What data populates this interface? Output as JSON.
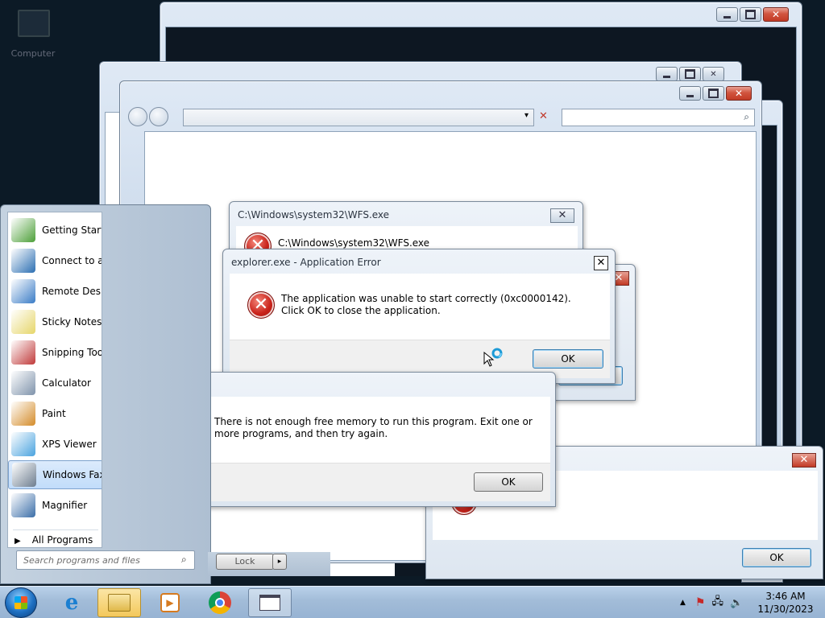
{
  "desktop": {
    "computer_icon_label": "Computer"
  },
  "explorer": {
    "search_icon": "search-icon"
  },
  "dialog_wfs": {
    "title": "C:\\Windows\\system32\\WFS.exe",
    "message": "C:\\Windows\\system32\\WFS.exe"
  },
  "dialog_explorer": {
    "title": "explorer.exe - Application Error",
    "message": "The application was unable to start correctly (0xc0000142). Click OK to close the application.",
    "ok_label": "OK"
  },
  "dialog_memory": {
    "message": "There is not enough free memory to run this program. Exit one or more programs, and then try again.",
    "ok_label": "OK"
  },
  "dialog_bottom_right": {
    "ok_label": "OK"
  },
  "dialog_partial": {
    "ok_label": "Lock"
  },
  "start_menu": {
    "items": [
      {
        "label": "Getting Starte",
        "icon": "getting-started-icon",
        "color": "#4c9f38"
      },
      {
        "label": "Connect to a",
        "icon": "projector-icon",
        "color": "#2c6fb2"
      },
      {
        "label": "Remote Deskt",
        "icon": "remote-desktop-icon",
        "color": "#3a7cc6"
      },
      {
        "label": "Sticky Notes",
        "icon": "sticky-notes-icon",
        "color": "#e6d66a"
      },
      {
        "label": "Snipping Too",
        "icon": "snipping-tool-icon",
        "color": "#c03a3a"
      },
      {
        "label": "Calculator",
        "icon": "calculator-icon",
        "color": "#7f93ab"
      },
      {
        "label": "Paint",
        "icon": "paint-icon",
        "color": "#d48c2a"
      },
      {
        "label": "XPS Viewer",
        "icon": "xps-viewer-icon",
        "color": "#4aa3df"
      },
      {
        "label": "Windows Fax",
        "icon": "fax-icon",
        "color": "#6d7d8f"
      },
      {
        "label": "Magnifier",
        "icon": "magnifier-icon",
        "color": "#3b6ea8"
      }
    ],
    "highlighted_index": 8,
    "all_programs": "All Programs",
    "search_placeholder": "Search programs and files"
  },
  "taskbar": {
    "pinned": [
      {
        "name": "internet-explorer",
        "icon": "internet-explorer-icon"
      },
      {
        "name": "windows-explorer",
        "icon": "folder-icon"
      },
      {
        "name": "media-player",
        "icon": "media-player-icon"
      },
      {
        "name": "chrome",
        "icon": "chrome-icon"
      },
      {
        "name": "window",
        "icon": "window-icon"
      }
    ],
    "time": "3:46 AM",
    "date": "11/30/2023"
  }
}
